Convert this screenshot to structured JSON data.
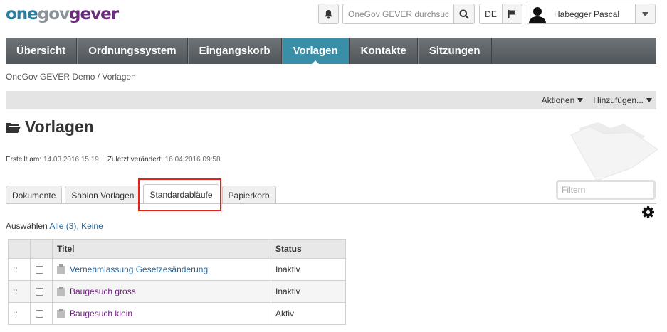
{
  "logo": {
    "part1": "one",
    "part2": "gov",
    "part3": "gever"
  },
  "search": {
    "placeholder": "OneGov GEVER durchsuchen"
  },
  "language": "DE",
  "user": {
    "name": "Habegger Pascal"
  },
  "nav": {
    "items": [
      {
        "label": "Übersicht",
        "active": false
      },
      {
        "label": "Ordnungssystem",
        "active": false
      },
      {
        "label": "Eingangskorb",
        "active": false
      },
      {
        "label": "Vorlagen",
        "active": true
      },
      {
        "label": "Kontakte",
        "active": false
      },
      {
        "label": "Sitzungen",
        "active": false
      }
    ]
  },
  "breadcrumb": "OneGov GEVER Demo / Vorlagen",
  "actions": {
    "aktionen": "Aktionen",
    "hinzufuegen": "Hinzufügen..."
  },
  "page": {
    "title": "Vorlagen"
  },
  "meta": {
    "created_label": "Erstellt am:",
    "created_value": "14.03.2016 15:19",
    "modified_label": "Zuletzt verändert:",
    "modified_value": "16.04.2016 09:58"
  },
  "tabs": [
    {
      "label": "Dokumente",
      "active": false
    },
    {
      "label": "Sablon Vorlagen",
      "active": false
    },
    {
      "label": "Standardabläufe",
      "active": true
    },
    {
      "label": "Papierkorb",
      "active": false
    }
  ],
  "filter": {
    "placeholder": "Filtern"
  },
  "select": {
    "label": "Auswählen",
    "all": "Alle (3),",
    "none": "Keine"
  },
  "table": {
    "headers": {
      "title": "Titel",
      "status": "Status"
    },
    "rows": [
      {
        "drag": "::",
        "title": "Vernehmlassung Gesetzesänderung",
        "status": "Inaktiv",
        "visited": false
      },
      {
        "drag": "::",
        "title": "Baugesuch gross",
        "status": "Inaktiv",
        "visited": true
      },
      {
        "drag": "::",
        "title": "Baugesuch klein",
        "status": "Aktiv",
        "visited": true
      }
    ]
  },
  "colors": {
    "nav_active": "#3a8fa8",
    "link": "#2a6496",
    "link_visited": "#6a1b7a",
    "highlight": "#e2231a"
  }
}
